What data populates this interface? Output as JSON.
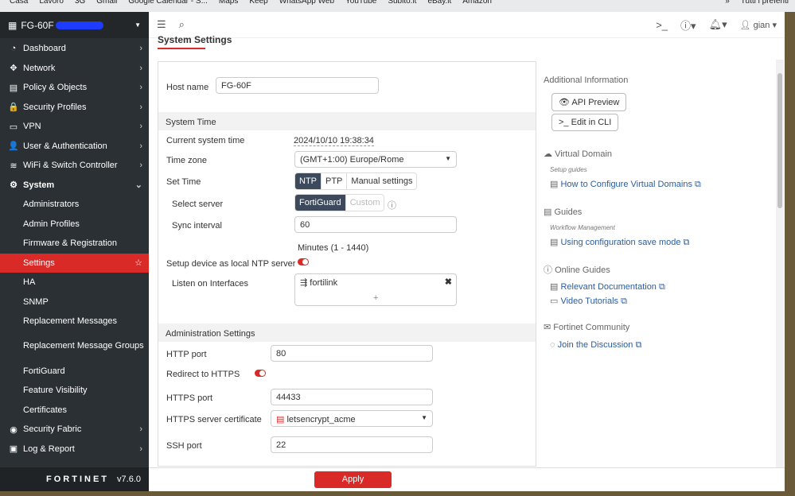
{
  "bookmarks": [
    "Casa",
    "Lavoro",
    "3G",
    "Gmail",
    "Google Calendar - S...",
    "Maps",
    "Keep",
    "WhatsApp Web",
    "YouTube",
    "Subito.it",
    "eBay.it",
    "Amazon",
    "»",
    "Tutti i preferiti"
  ],
  "device": "FG-60F",
  "version": "v7.6.0",
  "brand": "FORTINET",
  "user": "gian",
  "sidebar": [
    {
      "label": "Dashboard",
      "icon": "◔",
      "chev": "›"
    },
    {
      "label": "Network",
      "icon": "✥",
      "chev": "›"
    },
    {
      "label": "Policy & Objects",
      "icon": "▤",
      "chev": "›"
    },
    {
      "label": "Security Profiles",
      "icon": "🔒",
      "chev": "›"
    },
    {
      "label": "VPN",
      "icon": "▭",
      "chev": "›"
    },
    {
      "label": "User & Authentication",
      "icon": "👤",
      "chev": "›"
    },
    {
      "label": "WiFi & Switch Controller",
      "icon": "≋",
      "chev": "›"
    },
    {
      "label": "System",
      "icon": "⚙",
      "chev": "⌄"
    },
    {
      "label": "Administrators"
    },
    {
      "label": "Admin Profiles"
    },
    {
      "label": "Firmware & Registration"
    },
    {
      "label": "Settings",
      "chev": "☆"
    },
    {
      "label": "HA"
    },
    {
      "label": "SNMP"
    },
    {
      "label": "Replacement Messages"
    },
    {
      "label": "Replacement Message Groups"
    },
    {
      "label": "FortiGuard"
    },
    {
      "label": "Feature Visibility"
    },
    {
      "label": "Certificates"
    },
    {
      "label": "Security Fabric",
      "icon": "◉",
      "chev": "›"
    },
    {
      "label": "Log & Report",
      "icon": "▣",
      "chev": "›"
    }
  ],
  "page_title": "System Settings",
  "form": {
    "host_label": "Host name",
    "host_value": "FG-60F",
    "sys_time": "System Time",
    "cur_label": "Current system time",
    "cur_value": "2024/10/10 19:38:34",
    "tz_label": "Time zone",
    "tz_value": "(GMT+1:00) Europe/Rome",
    "set_label": "Set Time",
    "set_opts": [
      "NTP",
      "PTP",
      "Manual settings"
    ],
    "server_label": "Select server",
    "server_opts": [
      "FortiGuard",
      "Custom"
    ],
    "sync_label": "Sync interval",
    "sync_value": "60",
    "sync_hint": "Minutes (1 - 1440)",
    "ntp_label": "Setup device as local NTP server",
    "listen_label": "Listen on Interfaces",
    "listen_value": "fortilink",
    "add": "+",
    "admin": "Administration Settings",
    "http_label": "HTTP port",
    "http_value": "80",
    "redir_label": "Redirect to HTTPS",
    "https_label": "HTTPS port",
    "https_value": "44433",
    "cert_label": "HTTPS server certificate",
    "cert_value": "letsencrypt_acme",
    "ssh_label": "SSH port",
    "ssh_value": "22"
  },
  "right": {
    "title": "Additional Information",
    "api": "API Preview",
    "cli": "Edit in CLI",
    "vd": "Virtual Domain",
    "vd_sub": "Setup guides",
    "vd_link": "How to Configure Virtual Domains",
    "guides": "Guides",
    "g_sub": "Workflow Management",
    "g_link": "Using configuration save mode",
    "online": "Online Guides",
    "o_link1": "Relevant Documentation",
    "o_link2": "Video Tutorials",
    "comm": "Fortinet Community",
    "c_link": "Join the Discussion"
  },
  "apply": "Apply"
}
